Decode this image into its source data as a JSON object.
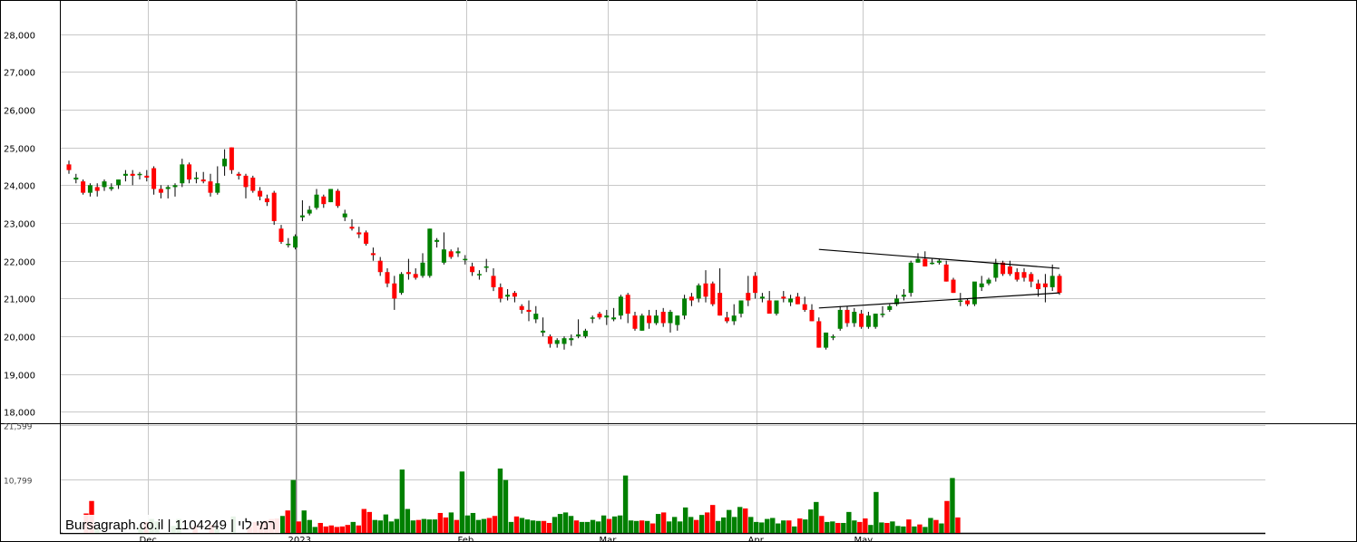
{
  "chart_data": {
    "type": "candlestick",
    "price_axis": {
      "ylim": [
        17700,
        28900
      ],
      "ticks": [
        18000,
        19000,
        20000,
        21000,
        22000,
        23000,
        24000,
        25000,
        26000,
        27000,
        28000
      ],
      "tick_labels": [
        "18,000",
        "19,000",
        "20,000",
        "21,000",
        "22,000",
        "23,000",
        "24,000",
        "25,000",
        "26,000",
        "27,000",
        "28,000"
      ]
    },
    "volume_axis": {
      "ylim": [
        0,
        21599
      ],
      "ticks": [
        10799,
        21599
      ],
      "tick_labels": [
        "10,799",
        "21,599"
      ]
    },
    "months": [
      {
        "label": "Dec",
        "index": 6
      },
      {
        "label": "2023",
        "index": 27
      },
      {
        "label": "Feb",
        "index": 51
      },
      {
        "label": "Mar",
        "index": 71
      },
      {
        "label": "Apr",
        "index": 92
      },
      {
        "label": "May",
        "index": 107
      }
    ],
    "candles": [
      [
        24550,
        24650,
        24300,
        24400
      ],
      [
        24150,
        24300,
        24050,
        24200
      ],
      [
        24100,
        24150,
        23750,
        23800
      ],
      [
        23800,
        24050,
        23700,
        24000
      ],
      [
        23950,
        24050,
        23700,
        23850
      ],
      [
        23950,
        24150,
        23850,
        24100
      ],
      [
        23900,
        24050,
        23850,
        23950
      ],
      [
        24000,
        24150,
        23900,
        24150
      ],
      [
        24250,
        24400,
        24100,
        24300
      ],
      [
        24300,
        24400,
        24000,
        24250
      ],
      [
        24300,
        24350,
        24150,
        24300
      ],
      [
        24250,
        24400,
        24100,
        24200
      ],
      [
        24450,
        24500,
        23750,
        23900
      ],
      [
        23900,
        24000,
        23650,
        23800
      ],
      [
        23900,
        24000,
        23650,
        23950
      ],
      [
        23950,
        24050,
        23700,
        24000
      ],
      [
        24050,
        24700,
        23950,
        24550
      ],
      [
        24550,
        24600,
        24050,
        24150
      ],
      [
        24200,
        24350,
        24050,
        24200
      ],
      [
        24150,
        24350,
        24050,
        24100
      ],
      [
        24100,
        24300,
        23700,
        23800
      ],
      [
        23800,
        24500,
        23750,
        24050
      ],
      [
        24500,
        24950,
        24250,
        24700
      ],
      [
        25000,
        25000,
        24300,
        24400
      ],
      [
        24300,
        24350,
        24150,
        24250
      ],
      [
        24250,
        24300,
        23650,
        23950
      ],
      [
        24200,
        24250,
        23800,
        23850
      ],
      [
        23850,
        23950,
        23600,
        23700
      ],
      [
        23650,
        23750,
        23450,
        23550
      ],
      [
        23800,
        23850,
        22950,
        23050
      ],
      [
        22850,
        22950,
        22450,
        22500
      ],
      [
        22450,
        22600,
        22350,
        22450
      ],
      [
        22350,
        22700,
        22300,
        22650
      ],
      [
        23150,
        23600,
        23050,
        23200
      ],
      [
        23250,
        23450,
        23200,
        23350
      ],
      [
        23400,
        23900,
        23350,
        23750
      ],
      [
        23700,
        23750,
        23400,
        23500
      ],
      [
        23550,
        23900,
        23550,
        23900
      ],
      [
        23850,
        23900,
        23400,
        23450
      ],
      [
        23150,
        23350,
        23050,
        23250
      ],
      [
        22900,
        23100,
        22800,
        22850
      ],
      [
        22750,
        22900,
        22600,
        22700
      ],
      [
        22750,
        22800,
        22400,
        22450
      ],
      [
        22200,
        22350,
        22000,
        22150
      ],
      [
        22000,
        22100,
        21600,
        21700
      ],
      [
        21700,
        21800,
        21300,
        21400
      ],
      [
        21400,
        21600,
        20700,
        21000
      ],
      [
        21150,
        21700,
        21100,
        21650
      ],
      [
        21700,
        22050,
        21500,
        21650
      ],
      [
        21650,
        21800,
        21500,
        21550
      ],
      [
        21600,
        22200,
        21550,
        21950
      ],
      [
        21600,
        22850,
        21550,
        22850
      ],
      [
        22500,
        22600,
        22350,
        22550
      ],
      [
        21950,
        22750,
        21900,
        22300
      ],
      [
        22250,
        22300,
        22050,
        22100
      ],
      [
        22200,
        22350,
        22100,
        22250
      ],
      [
        22050,
        22150,
        21900,
        22050
      ],
      [
        21850,
        21950,
        21600,
        21700
      ],
      [
        21650,
        21750,
        21500,
        21650
      ],
      [
        21850,
        22050,
        21700,
        21850
      ],
      [
        21600,
        21800,
        21200,
        21300
      ],
      [
        21300,
        21400,
        20900,
        21000
      ],
      [
        21050,
        21250,
        20950,
        21100
      ],
      [
        21150,
        21200,
        20900,
        21050
      ],
      [
        20800,
        20850,
        20600,
        20700
      ],
      [
        20700,
        20950,
        20400,
        20650
      ],
      [
        20450,
        20800,
        20350,
        20600
      ],
      [
        20100,
        20500,
        20000,
        20150
      ],
      [
        20000,
        20050,
        19700,
        19800
      ],
      [
        19800,
        19950,
        19700,
        19900
      ],
      [
        19800,
        20000,
        19650,
        19950
      ],
      [
        19900,
        20050,
        19750,
        19950
      ],
      [
        20000,
        20450,
        19950,
        20050
      ],
      [
        20000,
        20200,
        19950,
        20150
      ],
      [
        20500,
        20550,
        20350,
        20500
      ],
      [
        20600,
        20650,
        20450,
        20500
      ],
      [
        20500,
        20700,
        20300,
        20550
      ],
      [
        20450,
        20750,
        20400,
        20500
      ],
      [
        20550,
        21100,
        20450,
        21050
      ],
      [
        21100,
        21150,
        20350,
        20600
      ],
      [
        20550,
        20650,
        20150,
        20200
      ],
      [
        20150,
        20600,
        20150,
        20550
      ],
      [
        20550,
        20700,
        20200,
        20350
      ],
      [
        20350,
        20700,
        20300,
        20550
      ],
      [
        20650,
        20750,
        20250,
        20350
      ],
      [
        20350,
        20700,
        20100,
        20650
      ],
      [
        20300,
        20550,
        20150,
        20550
      ],
      [
        20550,
        21100,
        20450,
        21000
      ],
      [
        21050,
        21150,
        20800,
        20950
      ],
      [
        21000,
        21400,
        20900,
        21350
      ],
      [
        21400,
        21750,
        20900,
        21050
      ],
      [
        21400,
        21450,
        20800,
        20850
      ],
      [
        21150,
        21800,
        20550,
        20550
      ],
      [
        20500,
        20650,
        20350,
        20400
      ],
      [
        20400,
        20850,
        20300,
        20550
      ],
      [
        20600,
        20900,
        20500,
        20950
      ],
      [
        21150,
        21600,
        20800,
        20950
      ],
      [
        21600,
        21700,
        21000,
        21150
      ],
      [
        21000,
        21150,
        20900,
        21050
      ],
      [
        20950,
        21200,
        20750,
        20600
      ],
      [
        20600,
        20950,
        20550,
        20950
      ],
      [
        21050,
        21200,
        20900,
        21000
      ],
      [
        20900,
        21100,
        20800,
        21000
      ],
      [
        21050,
        21150,
        20850,
        20850
      ],
      [
        20850,
        21050,
        20650,
        20700
      ],
      [
        20700,
        20850,
        20400,
        20400
      ],
      [
        20400,
        20500,
        19700,
        19700
      ],
      [
        19700,
        20100,
        19650,
        20100
      ],
      [
        20000,
        20050,
        19900,
        20000
      ],
      [
        20200,
        20800,
        20150,
        20700
      ],
      [
        20700,
        20800,
        20250,
        20350
      ],
      [
        20350,
        20750,
        20250,
        20650
      ],
      [
        20600,
        20700,
        20200,
        20250
      ],
      [
        20250,
        20650,
        20200,
        20550
      ],
      [
        20250,
        20600,
        20200,
        20600
      ],
      [
        20600,
        20800,
        20500,
        20600
      ],
      [
        20700,
        20850,
        20650,
        20800
      ],
      [
        20850,
        21100,
        20800,
        21000
      ],
      [
        21050,
        21250,
        20950,
        21100
      ],
      [
        21150,
        22000,
        21050,
        21950
      ],
      [
        21950,
        22200,
        21950,
        22050
      ],
      [
        22050,
        22250,
        21850,
        21850
      ],
      [
        21950,
        22050,
        21900,
        21950
      ],
      [
        21950,
        22050,
        21900,
        22000
      ],
      [
        21900,
        22000,
        21450,
        21450
      ],
      [
        21500,
        21550,
        21150,
        21150
      ],
      [
        20950,
        21150,
        20800,
        20950
      ],
      [
        20950,
        21000,
        20800,
        20850
      ],
      [
        20850,
        21350,
        20800,
        21450
      ],
      [
        21300,
        21600,
        21200,
        21400
      ],
      [
        21400,
        21550,
        21350,
        21500
      ],
      [
        21550,
        22050,
        21450,
        21950
      ],
      [
        21950,
        22000,
        21600,
        21650
      ],
      [
        21850,
        22000,
        21600,
        21650
      ],
      [
        21700,
        21800,
        21450,
        21500
      ],
      [
        21700,
        21800,
        21450,
        21550
      ],
      [
        21650,
        21700,
        21300,
        21450
      ],
      [
        21400,
        21500,
        21050,
        21250
      ],
      [
        21400,
        21650,
        20900,
        21300
      ],
      [
        21300,
        21900,
        21200,
        21600
      ],
      [
        21600,
        21650,
        21100,
        21150
      ]
    ],
    "volumes": [
      3900,
      6400,
      1200,
      0,
      0,
      0,
      0,
      0,
      0,
      0,
      1100,
      2200,
      2800,
      2300,
      0,
      0,
      1400,
      2800,
      0,
      0,
      1400,
      0,
      0,
      1600,
      1000,
      0,
      0,
      3300,
      0,
      0,
      1200,
      2200,
      2000,
      2500,
      2800,
      2900,
      3400,
      4500,
      10600,
      2300,
      4500,
      2600,
      1200,
      2000,
      1300,
      1500,
      1200,
      1300,
      1600,
      2200,
      1500,
      4800,
      4200,
      2600,
      2500,
      3700,
      2300,
      2800,
      12700,
      4800,
      2500,
      2600,
      2800,
      2700,
      2700,
      4000,
      3100,
      4100,
      2600,
      12300,
      3500,
      4000,
      2600,
      2800,
      3000,
      3400,
      12900,
      10600,
      2200,
      3300,
      3000,
      2700,
      2500,
      2400,
      2400,
      2000,
      3200,
      3800,
      4100,
      3400,
      2500,
      2200,
      2200,
      2600,
      2300,
      3500,
      2800,
      3300,
      3500,
      11500,
      2500,
      2400,
      2500,
      2400,
      1900,
      3800,
      4100,
      2300,
      3200,
      2300,
      5100,
      3200,
      2600,
      3600,
      4100,
      5600,
      2400,
      3100,
      4600,
      3200,
      5200,
      4900,
      3200,
      2200,
      2100,
      2800,
      3000,
      1900,
      2500,
      2500,
      1300,
      2900,
      2700,
      4700,
      6200,
      3400,
      2200,
      2300,
      2000,
      2000,
      4200,
      2500,
      2200,
      2900,
      1600,
      8200,
      2100,
      2000,
      2300,
      1400,
      1300,
      2700,
      1300,
      1700,
      1200,
      3000,
      2600,
      1900,
      6400,
      11000,
      3100
    ],
    "volume_colors": [
      "r",
      "r",
      "g",
      "",
      "",
      "",
      "",
      "",
      "",
      "",
      "g",
      "r",
      "g",
      "g",
      "",
      "",
      "g",
      "g",
      "",
      "",
      "r",
      "",
      "",
      "r",
      "g",
      "",
      "",
      "g",
      "",
      "",
      "r",
      "r",
      "r",
      "r",
      "r",
      "r",
      "g",
      "r",
      "g",
      "r",
      "g",
      "g",
      "g",
      "r",
      "r",
      "r",
      "r",
      "r",
      "r",
      "g",
      "r",
      "r",
      "r",
      "g",
      "g",
      "g",
      "g",
      "g",
      "g",
      "g",
      "g",
      "r",
      "g",
      "g",
      "g",
      "r",
      "r",
      "g",
      "r",
      "g",
      "g",
      "g",
      "g",
      "g",
      "r",
      "r",
      "g",
      "g",
      "g",
      "r",
      "g",
      "g",
      "g",
      "g",
      "r",
      "r",
      "g",
      "g",
      "g",
      "g",
      "r",
      "g",
      "g",
      "g",
      "g",
      "g",
      "r",
      "g",
      "g",
      "g",
      "g",
      "g",
      "r",
      "g",
      "r",
      "g",
      "r",
      "g",
      "g",
      "g",
      "g",
      "g",
      "r",
      "g",
      "r",
      "r",
      "g",
      "g",
      "g",
      "g",
      "g",
      "r",
      "g",
      "g",
      "g",
      "g",
      "g",
      "g",
      "g",
      "r",
      "g",
      "r",
      "g",
      "g",
      "g",
      "r",
      "g",
      "g",
      "r",
      "g",
      "g",
      "g",
      "r",
      "r",
      "g",
      "g",
      "g",
      "r",
      "g",
      "g",
      "g",
      "r",
      "g",
      "r",
      "g",
      "g",
      "r",
      "g",
      "r",
      "g",
      "r"
    ],
    "trendlines": [
      {
        "from_index": 106,
        "from_value": 22300,
        "to_index": 140,
        "to_value": 21800
      },
      {
        "from_index": 106,
        "from_value": 20750,
        "to_index": 140,
        "to_value": 21150
      }
    ],
    "colors": {
      "up": "#008000",
      "down": "#ff0000",
      "grid": "#c8c8c8",
      "axis": "#000000",
      "crosshair": "#7a7a7a"
    }
  },
  "watermark": {
    "site": "Bursagraph.co.il",
    "separator1": " | ",
    "code": "1104249",
    "separator2": " | ",
    "name": "רמי לוי"
  }
}
